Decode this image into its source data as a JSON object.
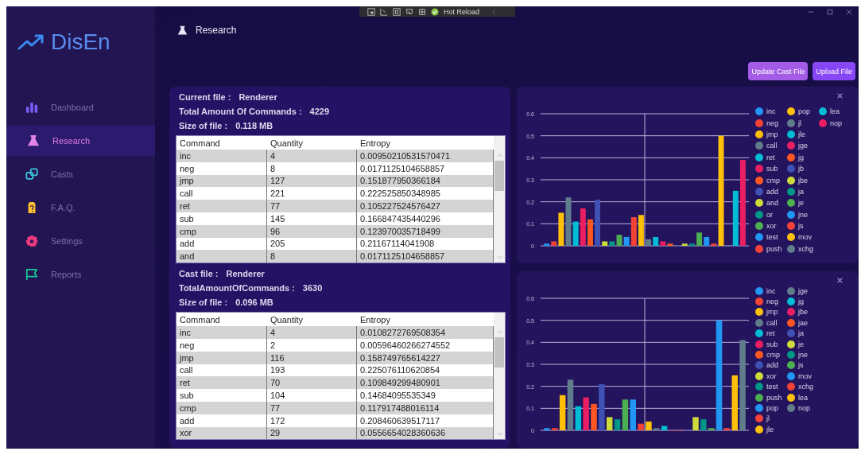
{
  "dev_toolbar": {
    "label": "Hot Reload"
  },
  "sidebar": {
    "logo": "DisEn",
    "items": [
      {
        "label": "Dashboard",
        "selected": false
      },
      {
        "label": "Research",
        "selected": true
      },
      {
        "label": "Casts",
        "selected": false
      },
      {
        "label": "F.A.Q.",
        "selected": false
      },
      {
        "label": "Settings",
        "selected": false
      },
      {
        "label": "Reports",
        "selected": false
      }
    ]
  },
  "header": {
    "title": "Research"
  },
  "actions": [
    "Update Cast File",
    "Upload File"
  ],
  "files": [
    {
      "name_label": "Current file :",
      "name": "Renderer",
      "total_label": "Total Amount Of Commands :",
      "total": "4229",
      "size_label": "Size of file :",
      "size": "0.118 MB",
      "table": {
        "columns": [
          "Command",
          "Quantity",
          "Entropy"
        ],
        "rows": [
          [
            "inc",
            "4",
            "0.00950210531570471"
          ],
          [
            "neg",
            "8",
            "0.0171125104658857"
          ],
          [
            "jmp",
            "127",
            "0.151877950366184"
          ],
          [
            "call",
            "221",
            "0.222525850348985"
          ],
          [
            "ret",
            "77",
            "0.105227524576427"
          ],
          [
            "sub",
            "145",
            "0.166847435440296"
          ],
          [
            "cmp",
            "96",
            "0.123970035718499"
          ],
          [
            "add",
            "205",
            "0.21167114041908"
          ],
          [
            "and",
            "8",
            "0.0171125104658857"
          ]
        ]
      }
    },
    {
      "name_label": "Cast file :",
      "name": "Renderer",
      "total_label": "TotalAmountOfCommands :",
      "total": "3630",
      "size_label": "Size of file :",
      "size": "0.096 MB",
      "table": {
        "columns": [
          "Command",
          "Quantity",
          "Entropy"
        ],
        "rows": [
          [
            "inc",
            "4",
            "0.0108272769508354"
          ],
          [
            "neg",
            "2",
            "0.00596460266274552"
          ],
          [
            "jmp",
            "116",
            "0.158749765614227"
          ],
          [
            "call",
            "193",
            "0.225076110620854"
          ],
          [
            "ret",
            "70",
            "0.109849299480901"
          ],
          [
            "sub",
            "104",
            "0.14684095535349"
          ],
          [
            "cmp",
            "77",
            "0.117917488016114"
          ],
          [
            "add",
            "172",
            "0.208460639517117"
          ],
          [
            "xor",
            "29",
            "0.0556654028360636"
          ]
        ]
      }
    }
  ],
  "charts": [
    {
      "chart_data": {
        "type": "bar",
        "grid": true,
        "ylim": [
          0,
          0.6
        ],
        "yticks": [
          0,
          0.1,
          0.2,
          0.3,
          0.4,
          0.5,
          0.6
        ],
        "series": [
          {
            "name": "inc",
            "color": "#2196f3",
            "values": [
              0.01
            ]
          },
          {
            "name": "neg",
            "color": "#f44336",
            "values": [
              0.02
            ]
          },
          {
            "name": "jmp",
            "color": "#ffc107",
            "values": [
              0.15
            ]
          },
          {
            "name": "call",
            "color": "#607d8b",
            "values": [
              0.22
            ]
          },
          {
            "name": "ret",
            "color": "#00bcd4",
            "values": [
              0.11
            ]
          },
          {
            "name": "sub",
            "color": "#e91e63",
            "values": [
              0.17
            ]
          },
          {
            "name": "cmp",
            "color": "#ff5722",
            "values": [
              0.12
            ]
          },
          {
            "name": "add",
            "color": "#3f51b5",
            "values": [
              0.21
            ]
          },
          {
            "name": "and",
            "color": "#cddc39",
            "values": [
              0.02
            ]
          },
          {
            "name": "or",
            "color": "#009688",
            "values": [
              0.02
            ]
          },
          {
            "name": "xor",
            "color": "#4caf50",
            "values": [
              0.05
            ]
          },
          {
            "name": "test",
            "color": "#2196f3",
            "values": [
              0.04
            ]
          },
          {
            "name": "push",
            "color": "#f44336",
            "values": [
              0.13
            ]
          },
          {
            "name": "pop",
            "color": "#ffc107",
            "values": [
              0.14
            ]
          },
          {
            "name": "jl",
            "color": "#607d8b",
            "values": [
              0.03
            ]
          },
          {
            "name": "jle",
            "color": "#00bcd4",
            "values": [
              0.04
            ]
          },
          {
            "name": "jge",
            "color": "#e91e63",
            "values": [
              0.02
            ]
          },
          {
            "name": "jg",
            "color": "#ff5722",
            "values": [
              0.01
            ]
          },
          {
            "name": "jb",
            "color": "#3f51b5",
            "values": [
              0
            ]
          },
          {
            "name": "jbe",
            "color": "#cddc39",
            "values": [
              0.01
            ]
          },
          {
            "name": "ja",
            "color": "#009688",
            "values": [
              0.01
            ]
          },
          {
            "name": "je",
            "color": "#4caf50",
            "values": [
              0.06
            ]
          },
          {
            "name": "jne",
            "color": "#2196f3",
            "values": [
              0.04
            ]
          },
          {
            "name": "js",
            "color": "#f44336",
            "values": [
              0.01
            ]
          },
          {
            "name": "mov",
            "color": "#ffc107",
            "values": [
              0.5
            ]
          },
          {
            "name": "xchg",
            "color": "#607d8b",
            "values": [
              0
            ]
          },
          {
            "name": "lea",
            "color": "#00bcd4",
            "values": [
              0.25
            ]
          },
          {
            "name": "nop",
            "color": "#e91e63",
            "values": [
              0.39
            ]
          }
        ]
      }
    },
    {
      "chart_data": {
        "type": "bar",
        "grid": true,
        "ylim": [
          0,
          0.6
        ],
        "yticks": [
          0,
          0.1,
          0.2,
          0.3,
          0.4,
          0.5,
          0.6
        ],
        "series": [
          {
            "name": "inc",
            "color": "#2196f3",
            "values": [
              0.01
            ]
          },
          {
            "name": "neg",
            "color": "#f44336",
            "values": [
              0.01
            ]
          },
          {
            "name": "jmp",
            "color": "#ffc107",
            "values": [
              0.16
            ]
          },
          {
            "name": "call",
            "color": "#607d8b",
            "values": [
              0.23
            ]
          },
          {
            "name": "ret",
            "color": "#00bcd4",
            "values": [
              0.11
            ]
          },
          {
            "name": "sub",
            "color": "#e91e63",
            "values": [
              0.15
            ]
          },
          {
            "name": "cmp",
            "color": "#ff5722",
            "values": [
              0.12
            ]
          },
          {
            "name": "add",
            "color": "#3f51b5",
            "values": [
              0.21
            ]
          },
          {
            "name": "xor",
            "color": "#cddc39",
            "values": [
              0.06
            ]
          },
          {
            "name": "test",
            "color": "#009688",
            "values": [
              0.05
            ]
          },
          {
            "name": "push",
            "color": "#4caf50",
            "values": [
              0.14
            ]
          },
          {
            "name": "pop",
            "color": "#2196f3",
            "values": [
              0.14
            ]
          },
          {
            "name": "jl",
            "color": "#f44336",
            "values": [
              0.03
            ]
          },
          {
            "name": "jle",
            "color": "#ffc107",
            "values": [
              0.04
            ]
          },
          {
            "name": "jge",
            "color": "#607d8b",
            "values": [
              0.01
            ]
          },
          {
            "name": "jg",
            "color": "#00bcd4",
            "values": [
              0.02
            ]
          },
          {
            "name": "jbe",
            "color": "#e91e63",
            "values": [
              0
            ]
          },
          {
            "name": "jae",
            "color": "#ff5722",
            "values": [
              0
            ]
          },
          {
            "name": "ja",
            "color": "#3f51b5",
            "values": [
              0
            ]
          },
          {
            "name": "je",
            "color": "#cddc39",
            "values": [
              0.06
            ]
          },
          {
            "name": "jne",
            "color": "#009688",
            "values": [
              0.05
            ]
          },
          {
            "name": "js",
            "color": "#4caf50",
            "values": [
              0.01
            ]
          },
          {
            "name": "mov",
            "color": "#2196f3",
            "values": [
              0.5
            ]
          },
          {
            "name": "xchg",
            "color": "#f44336",
            "values": [
              0.01
            ]
          },
          {
            "name": "lea",
            "color": "#ffc107",
            "values": [
              0.25
            ]
          },
          {
            "name": "nop",
            "color": "#607d8b",
            "values": [
              0.41
            ]
          }
        ]
      }
    }
  ]
}
